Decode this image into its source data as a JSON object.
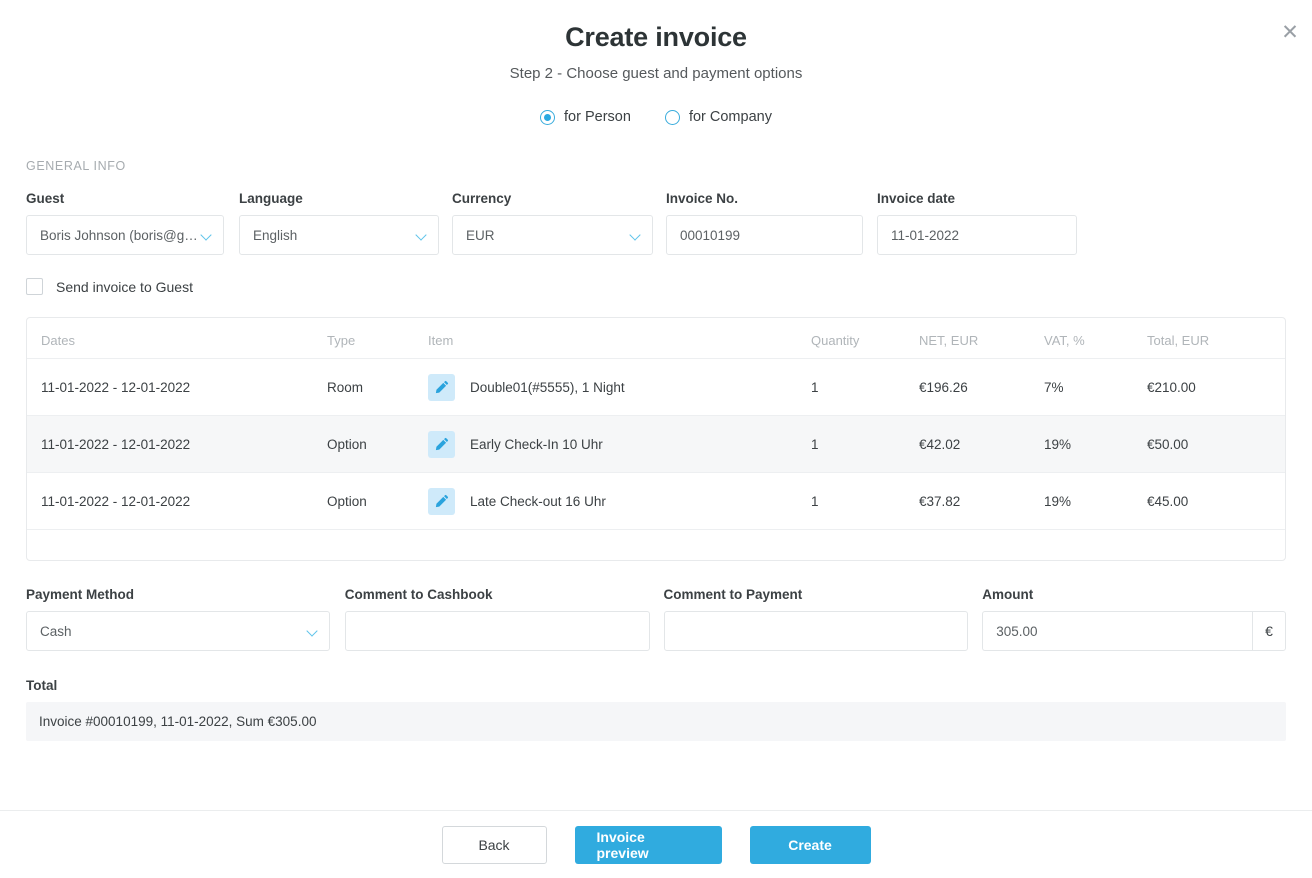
{
  "header": {
    "title": "Create invoice",
    "subtitle": "Step 2 - Choose guest and payment options",
    "close_icon": "close-icon"
  },
  "entity_type": {
    "options": [
      {
        "label": "for Person",
        "selected": true
      },
      {
        "label": "for Company",
        "selected": false
      }
    ]
  },
  "general_info": {
    "section_label": "GENERAL INFO",
    "guest": {
      "label": "Guest",
      "value": "Boris Johnson (boris@g…"
    },
    "language": {
      "label": "Language",
      "value": "English"
    },
    "currency": {
      "label": "Currency",
      "value": "EUR"
    },
    "invoice_no": {
      "label": "Invoice No.",
      "value": "00010199"
    },
    "invoice_date": {
      "label": "Invoice date",
      "value": "11-01-2022"
    },
    "send_invoice": {
      "label": "Send invoice to Guest",
      "checked": false
    }
  },
  "table": {
    "columns": [
      "Dates",
      "Type",
      "Item",
      "Quantity",
      "NET, EUR",
      "VAT, %",
      "Total, EUR"
    ],
    "rows": [
      {
        "dates": "11-01-2022 - 12-01-2022",
        "type": "Room",
        "item": "Double01(#5555), 1 Night",
        "quantity": "1",
        "net": "€196.26",
        "vat": "7%",
        "total": "€210.00"
      },
      {
        "dates": "11-01-2022 - 12-01-2022",
        "type": "Option",
        "item": "Early Check-In 10 Uhr",
        "quantity": "1",
        "net": "€42.02",
        "vat": "19%",
        "total": "€50.00"
      },
      {
        "dates": "11-01-2022 - 12-01-2022",
        "type": "Option",
        "item": "Late Check-out 16 Uhr",
        "quantity": "1",
        "net": "€37.82",
        "vat": "19%",
        "total": "€45.00"
      }
    ]
  },
  "payment": {
    "method": {
      "label": "Payment Method",
      "value": "Cash"
    },
    "comment_cashbook": {
      "label": "Comment to Cashbook",
      "value": ""
    },
    "comment_payment": {
      "label": "Comment to Payment",
      "value": ""
    },
    "amount": {
      "label": "Amount",
      "value": "305.00",
      "suffix": "€"
    }
  },
  "total": {
    "label": "Total",
    "summary": "Invoice #00010199, 11-01-2022, Sum €305.00"
  },
  "footer": {
    "back": "Back",
    "preview": "Invoice preview",
    "create": "Create"
  },
  "colors": {
    "accent": "#30abdf",
    "icon_bg": "#cfeafa",
    "row_alt": "#f6f7f8",
    "total_bg": "#f5f6f8"
  }
}
